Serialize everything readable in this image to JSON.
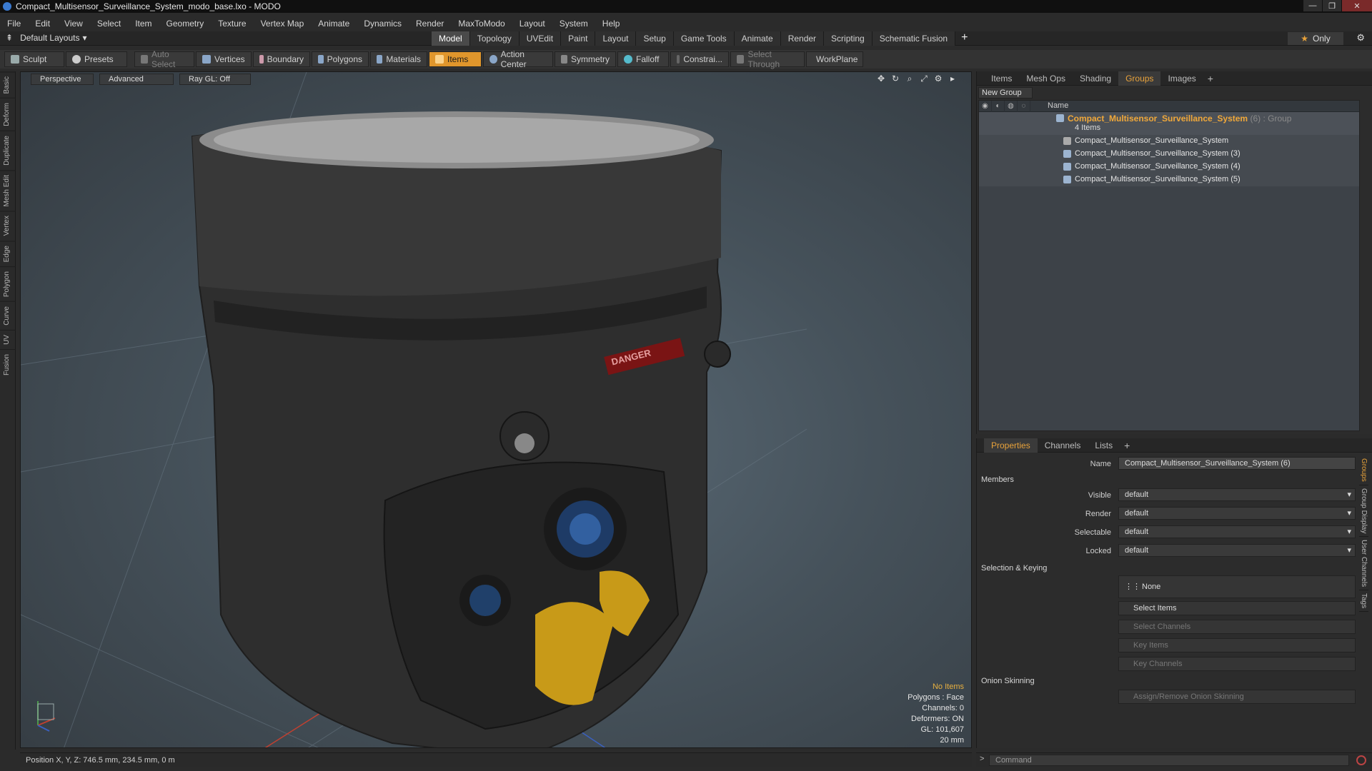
{
  "window": {
    "title": "Compact_Multisensor_Surveillance_System_modo_base.lxo - MODO",
    "controls": [
      "—",
      "❐",
      "✕"
    ]
  },
  "menu": [
    "File",
    "Edit",
    "View",
    "Select",
    "Item",
    "Geometry",
    "Texture",
    "Vertex Map",
    "Animate",
    "Dynamics",
    "Render",
    "MaxToModo",
    "Layout",
    "System",
    "Help"
  ],
  "layoutbar": {
    "layout_name": "Default Layouts",
    "tabs": [
      "Model",
      "Topology",
      "UVEdit",
      "Paint",
      "Layout",
      "Setup",
      "Game Tools",
      "Animate",
      "Render",
      "Scripting",
      "Schematic Fusion"
    ],
    "active_tab": "Model",
    "plus": "+",
    "only_label": "Only",
    "star": "★"
  },
  "toolbar": {
    "sculpt": "Sculpt",
    "presets": "Presets",
    "auto_select": "Auto Select",
    "vertices": "Vertices",
    "boundary": "Boundary",
    "polygons": "Polygons",
    "materials": "Materials",
    "items": "Items",
    "action_center": "Action Center",
    "symmetry": "Symmetry",
    "falloff": "Falloff",
    "constraints": "Constrai...",
    "select_through": "Select Through",
    "workplane": "WorkPlane"
  },
  "lefttabs": [
    "Basic",
    "Deform",
    "Duplicate",
    "Mesh Edit",
    "Vertex",
    "Edge",
    "Polygon",
    "Curve",
    "UV",
    "Fusion"
  ],
  "viewport": {
    "view": "Perspective",
    "advanced": "Advanced",
    "raygl": "Ray GL: Off",
    "stats": {
      "no_items": "No Items",
      "polygons": "Polygons : Face",
      "channels": "Channels: 0",
      "deformers": "Deformers: ON",
      "gl": "GL: 101,607",
      "scale": "20 mm"
    },
    "decal_text": "DANGER"
  },
  "position": "Position X, Y, Z:   746.5 mm, 234.5 mm, 0 m",
  "groups_panel": {
    "tabs": [
      "Items",
      "Mesh Ops",
      "Shading",
      "Groups",
      "Images"
    ],
    "active_tab": "Groups",
    "new_group": "New Group",
    "col_name": "Name",
    "group": {
      "name": "Compact_Multisensor_Surveillance_System",
      "meta": "(6) : Group",
      "count": "4 Items"
    },
    "children": [
      "Compact_Multisensor_Surveillance_System",
      "Compact_Multisensor_Surveillance_System (3)",
      "Compact_Multisensor_Surveillance_System (4)",
      "Compact_Multisensor_Surveillance_System (5)"
    ]
  },
  "properties": {
    "tabs": [
      "Properties",
      "Channels",
      "Lists"
    ],
    "active_tab": "Properties",
    "name_label": "Name",
    "name_value": "Compact_Multisensor_Surveillance_System (6)",
    "members": "Members",
    "visible_label": "Visible",
    "visible_value": "default",
    "render_label": "Render",
    "render_value": "default",
    "selectable_label": "Selectable",
    "selectable_value": "default",
    "locked_label": "Locked",
    "locked_value": "default",
    "selection_keying": "Selection & Keying",
    "none": "None",
    "select_items": "Select Items",
    "select_channels": "Select Channels",
    "key_items": "Key Items",
    "key_channels": "Key Channels",
    "onion": "Onion Skinning",
    "assign_onion": "Assign/Remove Onion Skinning",
    "side_tabs": [
      "Groups",
      "Group Display",
      "User Channels",
      "Tags"
    ]
  },
  "command": {
    "placeholder": "Command"
  }
}
